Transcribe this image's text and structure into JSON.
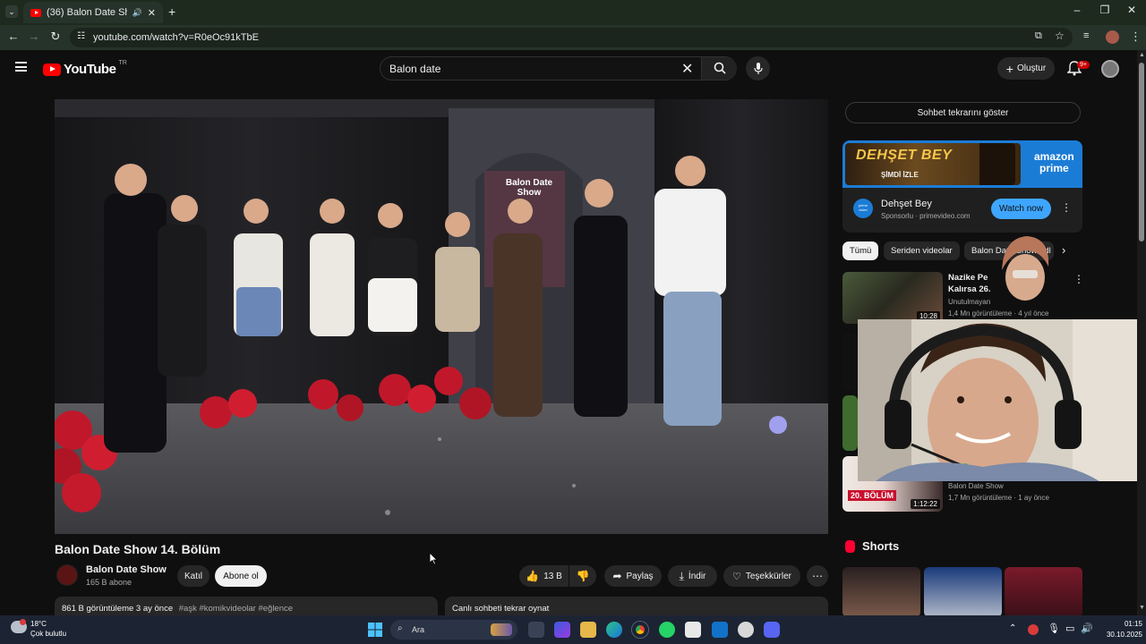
{
  "browser": {
    "tab_title": "(36) Balon Date Show 14. Bö",
    "url": "youtube.com/watch?v=R0eOc91kTbE"
  },
  "youtube": {
    "logo_text": "YouTube",
    "region": "TR",
    "search_value": "Balon date",
    "create_label": "Oluştur",
    "notification_count": "9+"
  },
  "video": {
    "title": "Balon Date Show 14. Bölüm",
    "channel_name": "Balon Date Show",
    "subscribers": "165 B abone",
    "join_label": "Katıl",
    "subscribe_label": "Abone ol",
    "likes": "13 B",
    "share_label": "Paylaş",
    "download_label": "İndir",
    "thanks_label": "Teşekkürler",
    "description_meta": "861 B görüntüleme  3 ay önce",
    "description_tags": "#aşk #komikvideolar #eğlence",
    "chat_replay_label": "Canlı sohbeti tekrar oynat",
    "set_sign": "Balon Date Show"
  },
  "sidebar": {
    "chat_button": "Sohbet tekrarını göster",
    "ad": {
      "poster_title": "DEHŞET BEY",
      "poster_sub": "ŞİMDİ İZLE",
      "brand_line1": "amazon",
      "brand_line2": "prime",
      "logo_text": "prime video",
      "title": "Dehşet Bey",
      "sponsor": "Sponsorlu · primevideo.com",
      "cta": "Watch now"
    },
    "chips": [
      "Tümü",
      "Seriden videolar",
      "Balon Date Show adl"
    ],
    "recs": [
      {
        "title1": "Nazike Pe",
        "title2": "Kalırsa 26.",
        "channel": "Unutulmayan",
        "meta": "1,4 Mn görüntüleme · 4 yıl önce",
        "duration": "10:28"
      },
      {
        "channel": "Balon Date Show",
        "meta": "1,7 Mn görüntüleme · 1 ay önce",
        "duration": "1:12:22",
        "badge": "20. BÖLÜM"
      }
    ],
    "shorts_label": "Shorts"
  },
  "taskbar": {
    "temperature": "18°C",
    "weather": "Çok bulutlu",
    "search_placeholder": "Ara",
    "time": "01:15",
    "date": "30.10.2025"
  },
  "colors": {
    "yt_red": "#ff0000",
    "background": "#0f0f0f",
    "cta_blue": "#3ea6ff",
    "prime_blue": "#1b7cd6"
  }
}
